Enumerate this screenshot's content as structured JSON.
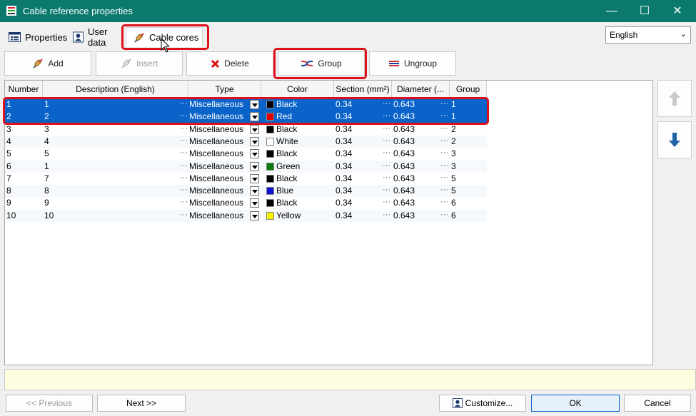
{
  "window": {
    "title": "Cable reference properties",
    "minimize_glyph": "—",
    "maximize_glyph": "☐",
    "close_glyph": "✕"
  },
  "tabs": [
    {
      "label": "Properties",
      "icon": "properties-icon"
    },
    {
      "label": "User data",
      "icon": "user-data-icon"
    },
    {
      "label": "Cable cores",
      "icon": "cable-core-icon",
      "active": true
    }
  ],
  "language": {
    "selected": "English"
  },
  "toolbar": {
    "add": "Add",
    "insert": "Insert",
    "delete": "Delete",
    "group": "Group",
    "ungroup": "Ungroup"
  },
  "grid": {
    "columns": [
      "Number",
      "Description (English)",
      "Type",
      "Color",
      "Section (mm²)",
      "Diameter (...",
      "Group"
    ],
    "dots": "···",
    "rows": [
      {
        "number": "1",
        "description": "1",
        "type": "Miscellaneous",
        "color": "Black",
        "color_hex": "#000000",
        "section": "0.34",
        "diameter": "0.643",
        "group": "1",
        "selected": true
      },
      {
        "number": "2",
        "description": "2",
        "type": "Miscellaneous",
        "color": "Red",
        "color_hex": "#e00000",
        "section": "0.34",
        "diameter": "0.643",
        "group": "1",
        "selected": true
      },
      {
        "number": "3",
        "description": "3",
        "type": "Miscellaneous",
        "color": "Black",
        "color_hex": "#000000",
        "section": "0.34",
        "diameter": "0.643",
        "group": "2"
      },
      {
        "number": "4",
        "description": "4",
        "type": "Miscellaneous",
        "color": "White",
        "color_hex": "#ffffff",
        "section": "0.34",
        "diameter": "0.643",
        "group": "2"
      },
      {
        "number": "5",
        "description": "5",
        "type": "Miscellaneous",
        "color": "Black",
        "color_hex": "#000000",
        "section": "0.34",
        "diameter": "0.643",
        "group": "3"
      },
      {
        "number": "6",
        "description": "1",
        "type": "Miscellaneous",
        "color": "Green",
        "color_hex": "#0a7a0a",
        "section": "0.34",
        "diameter": "0.643",
        "group": "3"
      },
      {
        "number": "7",
        "description": "7",
        "type": "Miscellaneous",
        "color": "Black",
        "color_hex": "#000000",
        "section": "0.34",
        "diameter": "0.643",
        "group": "5"
      },
      {
        "number": "8",
        "description": "8",
        "type": "Miscellaneous",
        "color": "Blue",
        "color_hex": "#1010d0",
        "section": "0.34",
        "diameter": "0.643",
        "group": "5"
      },
      {
        "number": "9",
        "description": "9",
        "type": "Miscellaneous",
        "color": "Black",
        "color_hex": "#000000",
        "section": "0.34",
        "diameter": "0.643",
        "group": "6"
      },
      {
        "number": "10",
        "description": "10",
        "type": "Miscellaneous",
        "color": "Yellow",
        "color_hex": "#f4f000",
        "section": "0.34",
        "diameter": "0.643",
        "group": "6"
      }
    ]
  },
  "side": {
    "up_icon": "arrow-up-icon",
    "down_icon": "arrow-down-icon"
  },
  "footer": {
    "previous": "<< Previous",
    "next": "Next >>",
    "customize": "Customize...",
    "ok": "OK",
    "cancel": "Cancel"
  },
  "colors": {
    "titlebar": "#0b7a6c",
    "selection": "#0a63c9",
    "highlight": "#e0101b"
  }
}
